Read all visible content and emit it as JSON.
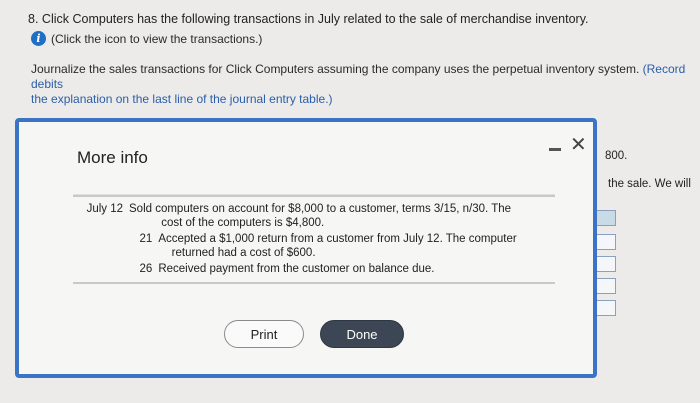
{
  "question": {
    "number": "8.",
    "text": "Click Computers has the following transactions in July related to the sale of merchandise inventory."
  },
  "info_link": {
    "icon": "info-icon",
    "text": "(Click the icon to view the transactions.)"
  },
  "instructions": {
    "line1": "Journalize the sales transactions for Click Computers assuming the company uses the perpetual inventory system.",
    "line1_blue": "(Record debits",
    "line2_blue": "the explanation on the last line of the journal entry table.)"
  },
  "background_peek": {
    "value": "800.",
    "text": "the sale. We will"
  },
  "modal": {
    "title": "More info",
    "minimize_icon": "minimize-icon",
    "close_icon": "close-icon",
    "close_glyph": "✕",
    "transactions": [
      {
        "date": "July 12",
        "lines": [
          "Sold computers on account for $8,000 to a customer, terms 3/15, n/30. The",
          "cost of the computers is $4,800."
        ]
      },
      {
        "date": "21",
        "lines": [
          "Accepted a $1,000 return from a customer from July 12. The computer",
          "returned had a cost of $600."
        ]
      },
      {
        "date": "26",
        "lines": [
          "Received payment from the customer on balance due."
        ]
      }
    ],
    "print_label": "Print",
    "done_label": "Done"
  },
  "colors": {
    "accent": "#3b74c6",
    "done_button": "#3c4654",
    "info_icon": "#1f6fc4"
  }
}
